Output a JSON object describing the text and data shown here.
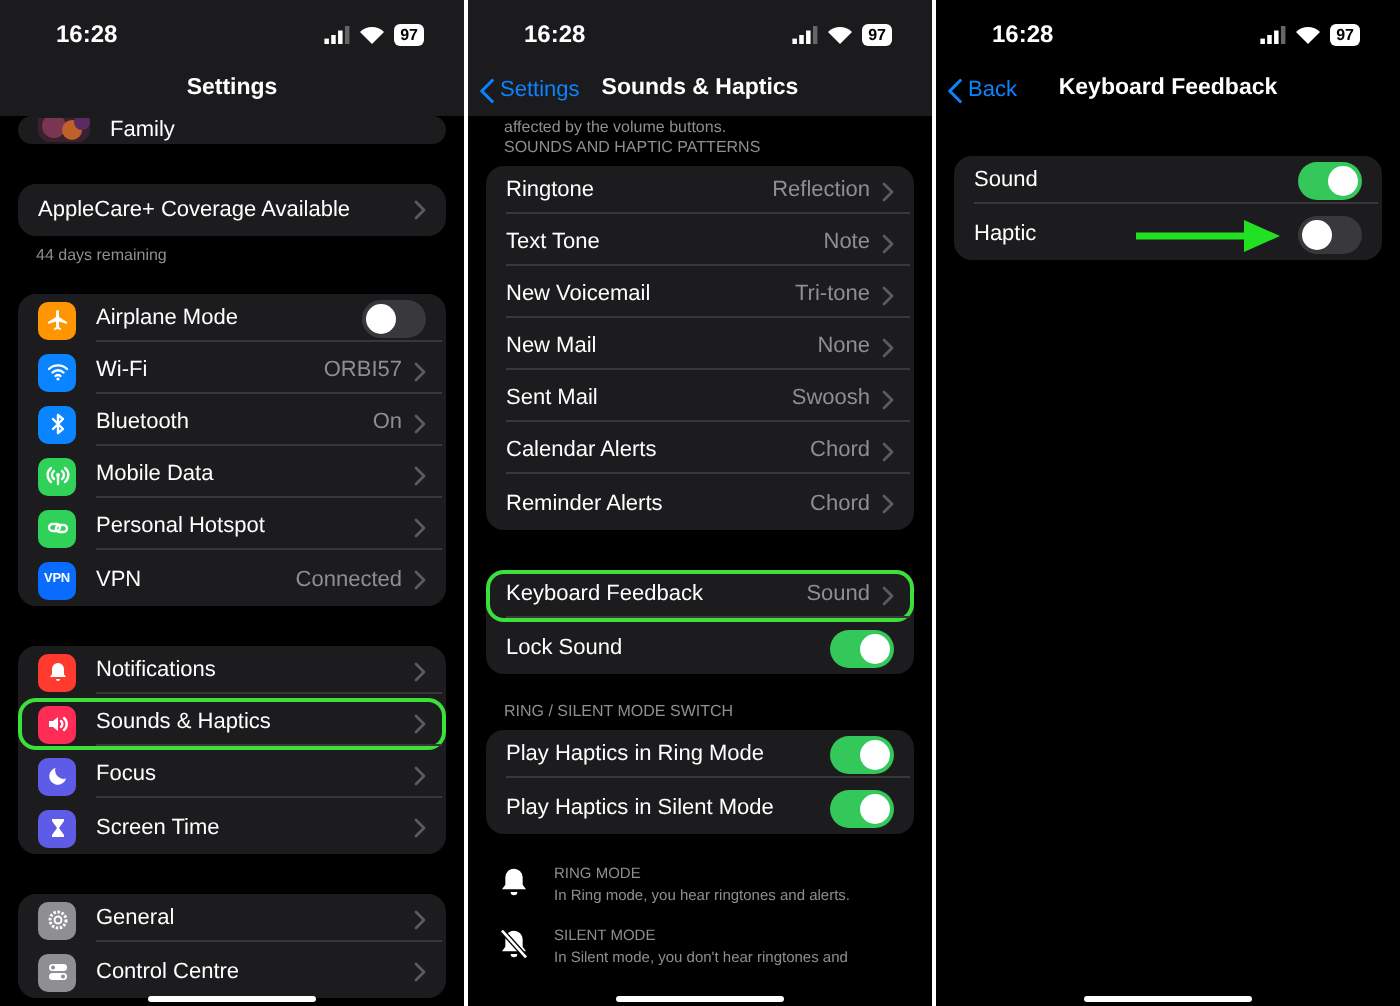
{
  "screens": [
    {
      "status_bar": {
        "time": "16:28",
        "battery": "97"
      },
      "scrolled_under": true,
      "nav": {
        "title": "Settings"
      },
      "sections": [
        {
          "rows": [
            {
              "kind": "avatar",
              "label": "Family",
              "highlighted": false,
              "pointed": false
            }
          ]
        },
        {
          "rows": [
            {
              "kind": "nav",
              "label": "AppleCare+ Coverage Available",
              "highlighted": false,
              "pointed": false
            }
          ],
          "footer": "44 days remaining"
        },
        {
          "rows": [
            {
              "kind": "toggle",
              "label": "Airplane Mode",
              "color": "#ff9500",
              "on": false,
              "highlighted": false,
              "pointed": false
            },
            {
              "kind": "nav",
              "label": "Wi-Fi",
              "value": "ORBI57",
              "color": "#0a84ff",
              "highlighted": false,
              "pointed": false
            },
            {
              "kind": "nav",
              "label": "Bluetooth",
              "value": "On",
              "color": "#0a84ff",
              "highlighted": false,
              "pointed": false
            },
            {
              "kind": "nav",
              "label": "Mobile Data",
              "color": "#30d158",
              "highlighted": false,
              "pointed": false
            },
            {
              "kind": "nav",
              "label": "Personal Hotspot",
              "color": "#30d158",
              "highlighted": false,
              "pointed": false
            },
            {
              "kind": "nav",
              "label": "VPN",
              "value": "Connected",
              "color": "#0a6cff",
              "icon_text": "VPN",
              "highlighted": false,
              "pointed": false
            }
          ]
        },
        {
          "rows": [
            {
              "kind": "nav",
              "label": "Notifications",
              "color": "#ff3b30",
              "highlighted": false,
              "pointed": false
            },
            {
              "kind": "nav",
              "label": "Sounds & Haptics",
              "color": "#ff2d55",
              "highlighted": true,
              "pointed": false
            },
            {
              "kind": "nav",
              "label": "Focus",
              "color": "#5e5ce6",
              "highlighted": false,
              "pointed": false
            },
            {
              "kind": "nav",
              "label": "Screen Time",
              "color": "#5e5ce6",
              "highlighted": false,
              "pointed": false
            }
          ]
        },
        {
          "rows": [
            {
              "kind": "nav",
              "label": "General",
              "color": "#8e8e93",
              "highlighted": false,
              "pointed": false
            },
            {
              "kind": "nav",
              "label": "Control Centre",
              "color": "#8e8e93",
              "highlighted": false,
              "pointed": false
            }
          ]
        }
      ]
    },
    {
      "status_bar": {
        "time": "16:28",
        "battery": "97"
      },
      "scrolled_under": true,
      "nav": {
        "back": "Settings",
        "title": "Sounds & Haptics"
      },
      "intro": "affected by the volume buttons.",
      "sections": [
        {
          "header": "SOUNDS AND HAPTIC PATTERNS",
          "rows": [
            {
              "kind": "nav",
              "label": "Ringtone",
              "value": "Reflection",
              "highlighted": false,
              "pointed": false
            },
            {
              "kind": "nav",
              "label": "Text Tone",
              "value": "Note",
              "highlighted": false,
              "pointed": false
            },
            {
              "kind": "nav",
              "label": "New Voicemail",
              "value": "Tri-tone",
              "highlighted": false,
              "pointed": false
            },
            {
              "kind": "nav",
              "label": "New Mail",
              "value": "None",
              "highlighted": false,
              "pointed": false
            },
            {
              "kind": "nav",
              "label": "Sent Mail",
              "value": "Swoosh",
              "highlighted": false,
              "pointed": false
            },
            {
              "kind": "nav",
              "label": "Calendar Alerts",
              "value": "Chord",
              "highlighted": false,
              "pointed": false
            },
            {
              "kind": "nav",
              "label": "Reminder Alerts",
              "value": "Chord",
              "highlighted": false,
              "pointed": false
            }
          ]
        },
        {
          "rows": [
            {
              "kind": "nav",
              "label": "Keyboard Feedback",
              "value": "Sound",
              "highlighted": true,
              "pointed": false
            },
            {
              "kind": "toggle",
              "label": "Lock Sound",
              "on": true,
              "highlighted": false,
              "pointed": false
            }
          ]
        },
        {
          "header": "RING / SILENT MODE SWITCH",
          "rows": [
            {
              "kind": "toggle",
              "label": "Play Haptics in Ring Mode",
              "on": true,
              "highlighted": false,
              "pointed": false
            },
            {
              "kind": "toggle",
              "label": "Play Haptics in Silent Mode",
              "on": true,
              "highlighted": false,
              "pointed": false
            }
          ]
        }
      ],
      "modes": [
        {
          "kind": "ring",
          "title": "RING MODE",
          "description": "In Ring mode, you hear ringtones and alerts."
        },
        {
          "kind": "silent",
          "title": "SILENT MODE",
          "description": "In Silent mode, you don't hear ringtones and"
        }
      ]
    },
    {
      "status_bar": {
        "time": "16:28",
        "battery": "97"
      },
      "scrolled_under": false,
      "nav": {
        "back": "Back",
        "title": "Keyboard Feedback"
      },
      "sections": [
        {
          "rows": [
            {
              "kind": "toggle",
              "label": "Sound",
              "on": true,
              "highlighted": false,
              "pointed": false
            },
            {
              "kind": "toggle",
              "label": "Haptic",
              "on": false,
              "highlighted": false,
              "pointed": true
            }
          ]
        }
      ]
    }
  ]
}
